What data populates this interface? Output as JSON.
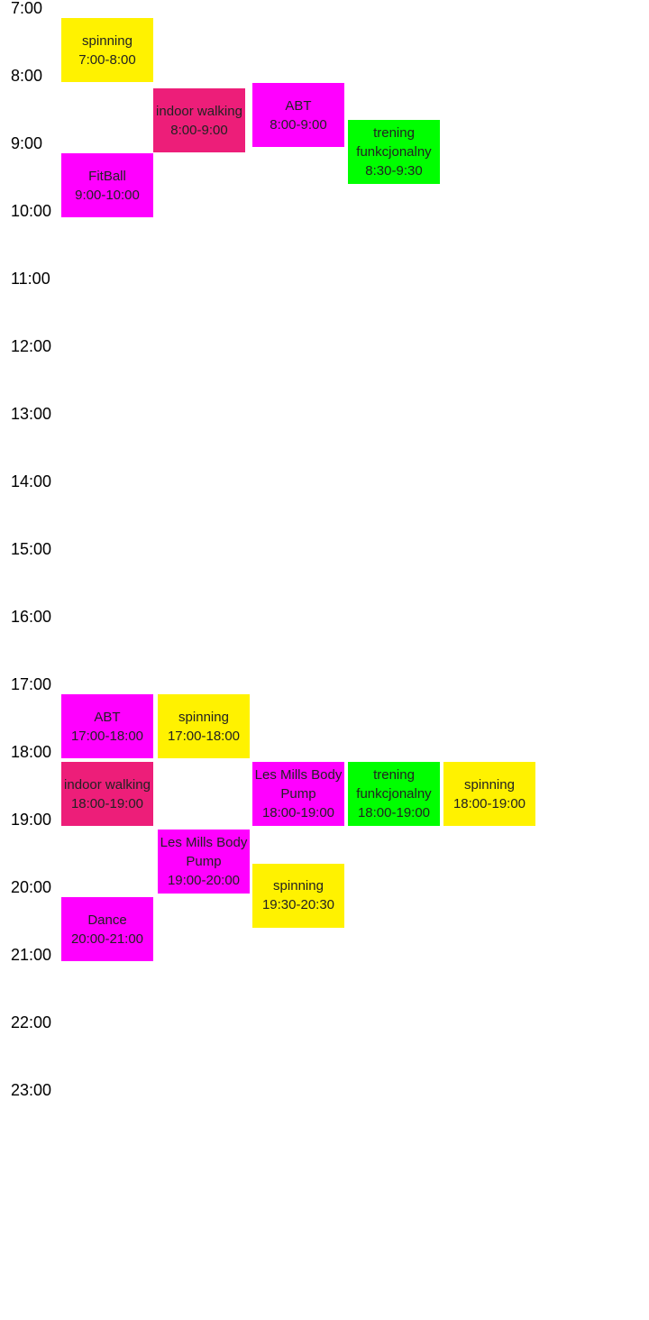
{
  "hours": [
    "7:00",
    "8:00",
    "9:00",
    "10:00",
    "11:00",
    "12:00",
    "13:00",
    "14:00",
    "15:00",
    "16:00",
    "17:00",
    "18:00",
    "19:00",
    "20:00",
    "21:00",
    "22:00",
    "23:00"
  ],
  "colors": {
    "yellow": "#fff200",
    "magenta": "#ff00ff",
    "crimson": "#ed1e79",
    "green": "#00ff00"
  },
  "classes": [
    {
      "name": "spinning",
      "time": "7:00-8:00",
      "color": "yellow",
      "start": "7:00",
      "end": "8:00"
    },
    {
      "name": "indoor walking",
      "time": "8:00-9:00",
      "color": "crimson",
      "start": "8:00",
      "end": "9:00"
    },
    {
      "name": "ABT",
      "time": "8:00-9:00",
      "color": "magenta",
      "start": "8:00",
      "end": "9:00"
    },
    {
      "name": "trening funkcjonalny",
      "time": "8:30-9:30",
      "color": "green",
      "start": "8:30",
      "end": "9:30"
    },
    {
      "name": "FitBall",
      "time": "9:00-10:00",
      "color": "magenta",
      "start": "9:00",
      "end": "10:00"
    },
    {
      "name": "ABT",
      "time": "17:00-18:00",
      "color": "magenta",
      "start": "17:00",
      "end": "18:00"
    },
    {
      "name": "spinning",
      "time": "17:00-18:00",
      "color": "yellow",
      "start": "17:00",
      "end": "18:00"
    },
    {
      "name": "indoor walking",
      "time": "18:00-19:00",
      "color": "crimson",
      "start": "18:00",
      "end": "19:00"
    },
    {
      "name": "Les Mills Body Pump",
      "time": "18:00-19:00",
      "color": "magenta",
      "start": "18:00",
      "end": "19:00"
    },
    {
      "name": "trening funkcjonalny",
      "time": "18:00-19:00",
      "color": "green",
      "start": "18:00",
      "end": "19:00"
    },
    {
      "name": "spinning",
      "time": "18:00-19:00",
      "color": "yellow",
      "start": "18:00",
      "end": "19:00"
    },
    {
      "name": "Les Mills Body Pump",
      "time": "19:00-20:00",
      "color": "magenta",
      "start": "19:00",
      "end": "20:00"
    },
    {
      "name": "spinning",
      "time": "19:30-20:30",
      "color": "yellow",
      "start": "19:30",
      "end": "20:30"
    },
    {
      "name": "Dance",
      "time": "20:00-21:00",
      "color": "magenta",
      "start": "20:00",
      "end": "21:00"
    }
  ]
}
